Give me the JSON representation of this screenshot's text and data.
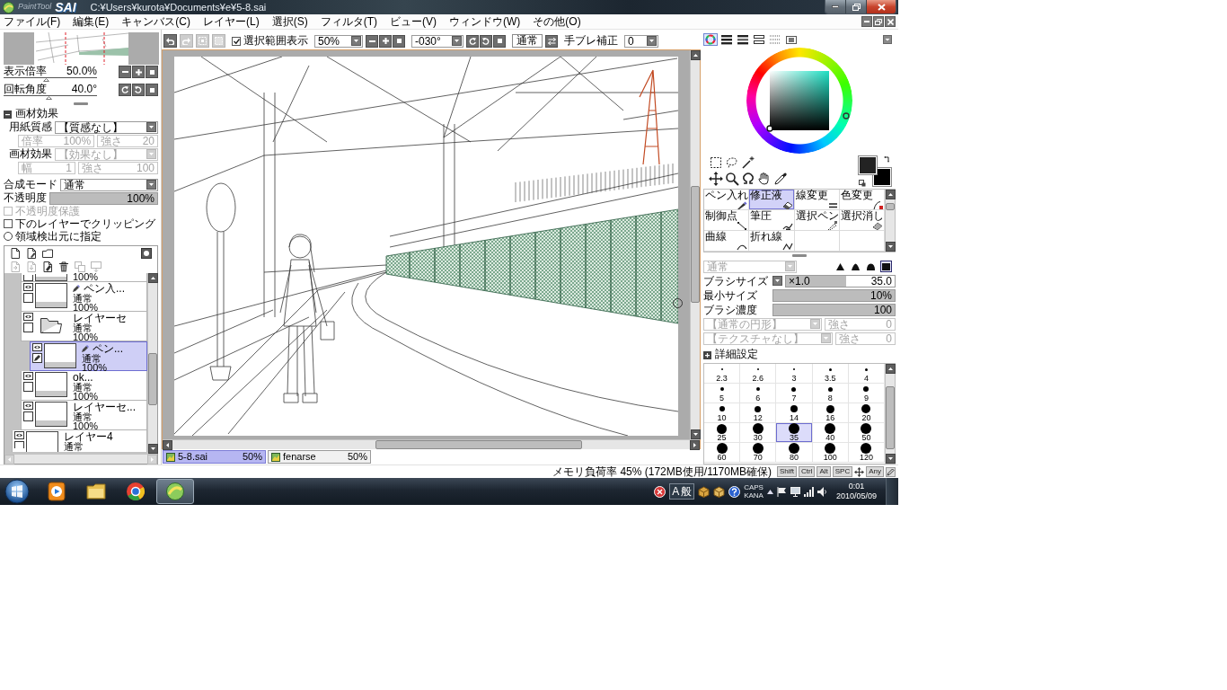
{
  "window": {
    "app_name": "PaintTool",
    "app_brand": "SAI",
    "title": "C:¥Users¥kurota¥Documents¥e¥5-8.sai"
  },
  "menu": [
    "ファイル(F)",
    "編集(E)",
    "キャンバス(C)",
    "レイヤー(L)",
    "選択(S)",
    "フィルタ(T)",
    "ビュー(V)",
    "ウィンドウ(W)",
    "その他(O)"
  ],
  "toolbar": {
    "buttons": [
      {
        "kind": "undo",
        "disabled": false
      },
      {
        "kind": "redo",
        "disabled": true
      },
      {
        "kind": "deselect",
        "disabled": true
      },
      {
        "kind": "invert",
        "disabled": true
      }
    ],
    "selection_display": {
      "label": "選択範囲表示",
      "checked": true
    },
    "zoom": "50%",
    "rotation": "-030°",
    "view_mode": "通常",
    "stabilizer": {
      "label": "手ブレ補正",
      "value": "0"
    }
  },
  "navigator": {
    "zoom": {
      "label": "表示倍率",
      "value": "50.0%",
      "level": 0.45
    },
    "rotation": {
      "label": "回転角度",
      "value": "40.0°",
      "level": 0.48
    }
  },
  "material_effects": {
    "title": "画材効果",
    "expanded": true,
    "rows": [
      {
        "kind": "select",
        "label": "用紙質感",
        "value": "【質感なし】",
        "disabled": false
      },
      {
        "kind": "pair",
        "disabled": true,
        "fields": [
          {
            "label": "倍率",
            "value": "100%"
          },
          {
            "label": "強さ",
            "value": "20"
          }
        ]
      },
      {
        "kind": "select",
        "label": "画材効果",
        "value": "【効果なし】",
        "disabled": true
      },
      {
        "kind": "pair",
        "disabled": true,
        "fields": [
          {
            "label": "幅",
            "value": "1"
          },
          {
            "label": "強さ",
            "value": "100"
          }
        ]
      }
    ]
  },
  "layer_props": {
    "blend_mode": {
      "label": "合成モード",
      "value": "通常"
    },
    "opacity": {
      "label": "不透明度",
      "value": "100%",
      "level": 1
    }
  },
  "layer_options": [
    {
      "kind": "checkbox",
      "label": "不透明度保護",
      "checked": false,
      "disabled": true
    },
    {
      "kind": "checkbox",
      "label": "下のレイヤーでクリッピング",
      "checked": false,
      "disabled": false
    },
    {
      "kind": "radio",
      "label": "領域検出元に指定",
      "checked": false,
      "disabled": false
    }
  ],
  "layer_buttons": [
    [
      {
        "kind": "new-layer",
        "disabled": false
      },
      {
        "kind": "new-linework",
        "disabled": false
      },
      {
        "kind": "new-folder",
        "disabled": false
      },
      {
        "kind": "mask",
        "disabled": false
      }
    ],
    [
      {
        "kind": "copy",
        "disabled": true
      },
      {
        "kind": "merge",
        "disabled": true
      },
      {
        "kind": "clear",
        "disabled": false
      },
      {
        "kind": "delete",
        "disabled": false
      },
      {
        "kind": "transfer",
        "disabled": true
      },
      {
        "kind": "merge-down",
        "disabled": true
      }
    ]
  ],
  "layers": [
    {
      "kind": "group-contents",
      "children": [
        {
          "kind": "raster",
          "cut_top": true,
          "opacity": "100%",
          "selected": false
        },
        {
          "kind": "linework",
          "name": "ペン入...",
          "mode": "通常",
          "opacity": "100%",
          "visible": true,
          "selected": false
        },
        {
          "kind": "folder",
          "name": "レイヤーセ",
          "mode": "通常",
          "opacity": "100%",
          "visible": true,
          "selected": false,
          "children": [
            {
              "kind": "linework",
              "name": "ペン...",
              "mode": "通常",
              "opacity": "100%",
              "visible": true,
              "selected": true
            }
          ]
        },
        {
          "kind": "raster",
          "name": "ok...",
          "mode": "通常",
          "opacity": "100%",
          "visible": true,
          "selected": false
        },
        {
          "kind": "raster",
          "name": "レイヤーセ...",
          "mode": "通常",
          "opacity": "100%",
          "visible": true,
          "selected": false
        }
      ]
    },
    {
      "kind": "raster",
      "cut_bottom": true,
      "name": "レイヤー4",
      "mode": "通常",
      "visible": true,
      "selected": false
    }
  ],
  "color_tabs": [
    {
      "kind": "wheel",
      "selected": true
    },
    {
      "kind": "rgb",
      "selected": false
    },
    {
      "kind": "hsv",
      "selected": false
    },
    {
      "kind": "mixer",
      "selected": false
    },
    {
      "kind": "swatches",
      "selected": false
    },
    {
      "kind": "scratchpad",
      "selected": false
    }
  ],
  "swatches": [
    {
      "kind": "primary",
      "color": "#232323"
    },
    {
      "kind": "secondary",
      "color": "#000000"
    }
  ],
  "brushes": [
    {
      "kind": "pen",
      "label": "ペン入れ",
      "selected": false
    },
    {
      "kind": "eraser",
      "label": "修正液",
      "selected": true
    },
    {
      "kind": "stroke",
      "label": "線変更",
      "selected": false
    },
    {
      "kind": "recolor",
      "label": "色変更",
      "selected": false
    },
    {
      "kind": "points",
      "label": "制御点",
      "selected": false
    },
    {
      "kind": "pressure",
      "label": "筆圧",
      "selected": false
    },
    {
      "kind": "select-pen",
      "label": "選択ペン",
      "selected": false
    },
    {
      "kind": "select-eraser",
      "label": "選択消し",
      "selected": false
    },
    {
      "kind": "curve",
      "label": "曲線",
      "selected": false
    },
    {
      "kind": "polyline",
      "label": "折れ線",
      "selected": false
    }
  ],
  "brush_settings": {
    "mode": {
      "value": "通常",
      "disabled": true
    },
    "tips": [
      {
        "kind": "sharp",
        "selected": false
      },
      {
        "kind": "rounded",
        "selected": false
      },
      {
        "kind": "dome",
        "selected": false
      },
      {
        "kind": "flat",
        "selected": true
      }
    ],
    "size": {
      "label": "ブラシサイズ",
      "multiplier": "×1.0",
      "value": "35.0",
      "level": 0.55
    },
    "min_size": {
      "label": "最小サイズ",
      "value": "10%",
      "level": 1
    },
    "density": {
      "label": "ブラシ濃度",
      "value": "100",
      "level": 1
    },
    "shape": {
      "value": "【通常の円形】",
      "strength_label": "強さ",
      "strength": "0",
      "disabled": true
    },
    "texture": {
      "value": "【テクスチャなし】",
      "strength_label": "強さ",
      "strength": "0",
      "disabled": true
    }
  },
  "details": {
    "title": "詳細設定",
    "expanded": false
  },
  "size_presets": [
    {
      "label": "2.3",
      "selected": false
    },
    {
      "label": "2.6",
      "selected": false
    },
    {
      "label": "3",
      "selected": false
    },
    {
      "label": "3.5",
      "selected": false
    },
    {
      "label": "4",
      "selected": false
    },
    {
      "label": "5",
      "selected": false
    },
    {
      "label": "6",
      "selected": false
    },
    {
      "label": "7",
      "selected": false
    },
    {
      "label": "8",
      "selected": false
    },
    {
      "label": "9",
      "selected": false
    },
    {
      "label": "10",
      "selected": false
    },
    {
      "label": "12",
      "selected": false
    },
    {
      "label": "14",
      "selected": false
    },
    {
      "label": "16",
      "selected": false
    },
    {
      "label": "20",
      "selected": false
    },
    {
      "label": "25",
      "selected": false
    },
    {
      "label": "30",
      "selected": false
    },
    {
      "label": "35",
      "selected": true
    },
    {
      "label": "40",
      "selected": false
    },
    {
      "label": "50",
      "selected": false
    },
    {
      "label": "60",
      "selected": false
    },
    {
      "label": "70",
      "selected": false
    },
    {
      "label": "80",
      "selected": false
    },
    {
      "label": "100",
      "selected": false
    },
    {
      "label": "120",
      "selected": false
    }
  ],
  "canvas_tabs": [
    {
      "title": "5-8.sai",
      "zoom": "50%",
      "selected": true
    },
    {
      "title": "fenarse",
      "zoom": "50%",
      "selected": false
    }
  ],
  "status": {
    "memory": "メモリ負荷率 45% (172MB使用/1170MB確保)",
    "keys": [
      "Shift",
      "Ctrl",
      "Alt",
      "SPC",
      "Any"
    ]
  },
  "taskbar": {
    "apps": [
      {
        "kind": "player",
        "active": false
      },
      {
        "kind": "folder",
        "active": false
      },
      {
        "kind": "browser",
        "active": false
      },
      {
        "kind": "paint",
        "active": true
      }
    ],
    "ime": [
      "A",
      "般"
    ],
    "locks": [
      "CAPS",
      "KANA"
    ],
    "time": "0:01",
    "date": "2010/05/09"
  }
}
